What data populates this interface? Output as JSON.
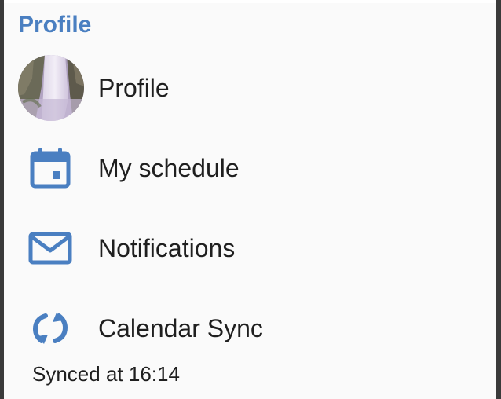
{
  "section": {
    "title": "Profile"
  },
  "menu": {
    "items": [
      {
        "label": "Profile",
        "icon": "avatar-photo"
      },
      {
        "label": "My schedule",
        "icon": "calendar-icon"
      },
      {
        "label": "Notifications",
        "icon": "envelope-icon"
      },
      {
        "label": "Calendar Sync",
        "icon": "sync-icon"
      }
    ]
  },
  "sync": {
    "status": "Synced at 16:14"
  },
  "colors": {
    "accent": "#4a7fc1",
    "text": "#1f1f1f",
    "background": "#fafafa"
  }
}
